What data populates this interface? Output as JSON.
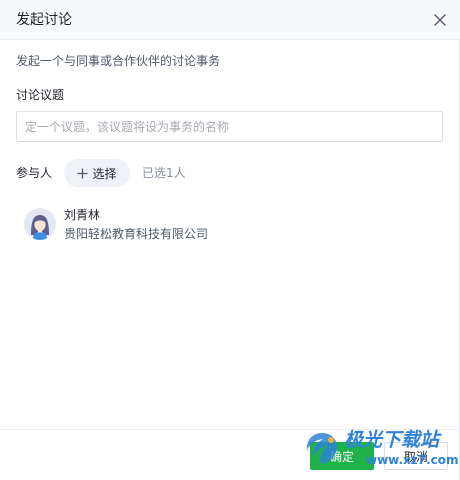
{
  "dialog": {
    "title": "发起讨论",
    "subtitle": "发起一个与同事或合作伙伴的讨论事务",
    "close_icon": "close-icon"
  },
  "topic": {
    "label": "讨论议题",
    "value": "",
    "placeholder": "定一个议题，该议题将设为事务的名称"
  },
  "participants": {
    "label": "参与人",
    "select_label": "选择",
    "select_icon": "plus-icon",
    "selected_count": "已选1人",
    "list": [
      {
        "name": "刘青林",
        "org": "贵阳轻松教育科技有限公司",
        "avatar_icon": "avatar-female"
      }
    ]
  },
  "footer": {
    "ok_label": "确定",
    "cancel_label": "取消"
  },
  "watermark": {
    "brand": "极光下载站",
    "url": "www.xz7.com"
  },
  "colors": {
    "primary": "#20b24a",
    "header_bg": "#f8f9fa",
    "chip_bg": "#eef1f6",
    "watermark": "#2f82d8"
  }
}
